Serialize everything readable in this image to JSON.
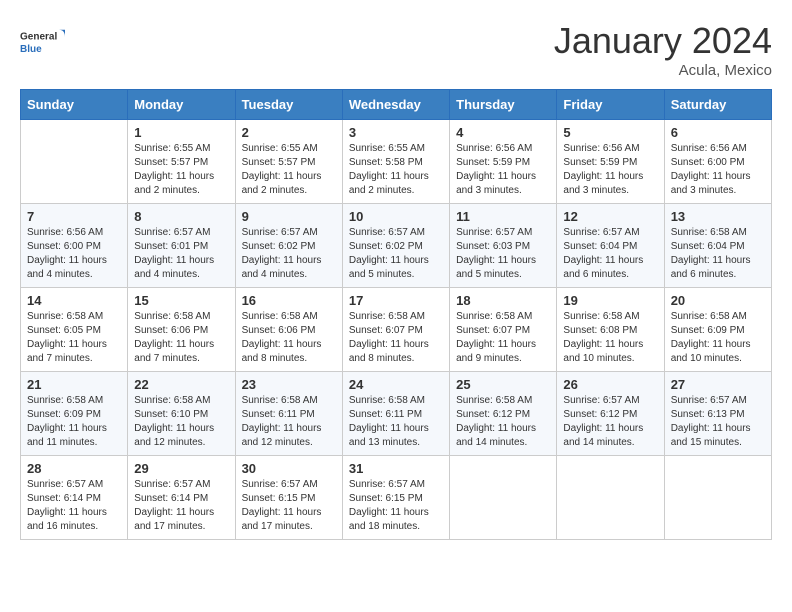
{
  "logo": {
    "general": "General",
    "blue": "Blue"
  },
  "header": {
    "month": "January 2024",
    "location": "Acula, Mexico"
  },
  "weekdays": [
    "Sunday",
    "Monday",
    "Tuesday",
    "Wednesday",
    "Thursday",
    "Friday",
    "Saturday"
  ],
  "weeks": [
    [
      {
        "day": null,
        "sunrise": null,
        "sunset": null,
        "daylight": null
      },
      {
        "day": "1",
        "sunrise": "Sunrise: 6:55 AM",
        "sunset": "Sunset: 5:57 PM",
        "daylight": "Daylight: 11 hours and 2 minutes."
      },
      {
        "day": "2",
        "sunrise": "Sunrise: 6:55 AM",
        "sunset": "Sunset: 5:57 PM",
        "daylight": "Daylight: 11 hours and 2 minutes."
      },
      {
        "day": "3",
        "sunrise": "Sunrise: 6:55 AM",
        "sunset": "Sunset: 5:58 PM",
        "daylight": "Daylight: 11 hours and 2 minutes."
      },
      {
        "day": "4",
        "sunrise": "Sunrise: 6:56 AM",
        "sunset": "Sunset: 5:59 PM",
        "daylight": "Daylight: 11 hours and 3 minutes."
      },
      {
        "day": "5",
        "sunrise": "Sunrise: 6:56 AM",
        "sunset": "Sunset: 5:59 PM",
        "daylight": "Daylight: 11 hours and 3 minutes."
      },
      {
        "day": "6",
        "sunrise": "Sunrise: 6:56 AM",
        "sunset": "Sunset: 6:00 PM",
        "daylight": "Daylight: 11 hours and 3 minutes."
      }
    ],
    [
      {
        "day": "7",
        "sunrise": "Sunrise: 6:56 AM",
        "sunset": "Sunset: 6:00 PM",
        "daylight": "Daylight: 11 hours and 4 minutes."
      },
      {
        "day": "8",
        "sunrise": "Sunrise: 6:57 AM",
        "sunset": "Sunset: 6:01 PM",
        "daylight": "Daylight: 11 hours and 4 minutes."
      },
      {
        "day": "9",
        "sunrise": "Sunrise: 6:57 AM",
        "sunset": "Sunset: 6:02 PM",
        "daylight": "Daylight: 11 hours and 4 minutes."
      },
      {
        "day": "10",
        "sunrise": "Sunrise: 6:57 AM",
        "sunset": "Sunset: 6:02 PM",
        "daylight": "Daylight: 11 hours and 5 minutes."
      },
      {
        "day": "11",
        "sunrise": "Sunrise: 6:57 AM",
        "sunset": "Sunset: 6:03 PM",
        "daylight": "Daylight: 11 hours and 5 minutes."
      },
      {
        "day": "12",
        "sunrise": "Sunrise: 6:57 AM",
        "sunset": "Sunset: 6:04 PM",
        "daylight": "Daylight: 11 hours and 6 minutes."
      },
      {
        "day": "13",
        "sunrise": "Sunrise: 6:58 AM",
        "sunset": "Sunset: 6:04 PM",
        "daylight": "Daylight: 11 hours and 6 minutes."
      }
    ],
    [
      {
        "day": "14",
        "sunrise": "Sunrise: 6:58 AM",
        "sunset": "Sunset: 6:05 PM",
        "daylight": "Daylight: 11 hours and 7 minutes."
      },
      {
        "day": "15",
        "sunrise": "Sunrise: 6:58 AM",
        "sunset": "Sunset: 6:06 PM",
        "daylight": "Daylight: 11 hours and 7 minutes."
      },
      {
        "day": "16",
        "sunrise": "Sunrise: 6:58 AM",
        "sunset": "Sunset: 6:06 PM",
        "daylight": "Daylight: 11 hours and 8 minutes."
      },
      {
        "day": "17",
        "sunrise": "Sunrise: 6:58 AM",
        "sunset": "Sunset: 6:07 PM",
        "daylight": "Daylight: 11 hours and 8 minutes."
      },
      {
        "day": "18",
        "sunrise": "Sunrise: 6:58 AM",
        "sunset": "Sunset: 6:07 PM",
        "daylight": "Daylight: 11 hours and 9 minutes."
      },
      {
        "day": "19",
        "sunrise": "Sunrise: 6:58 AM",
        "sunset": "Sunset: 6:08 PM",
        "daylight": "Daylight: 11 hours and 10 minutes."
      },
      {
        "day": "20",
        "sunrise": "Sunrise: 6:58 AM",
        "sunset": "Sunset: 6:09 PM",
        "daylight": "Daylight: 11 hours and 10 minutes."
      }
    ],
    [
      {
        "day": "21",
        "sunrise": "Sunrise: 6:58 AM",
        "sunset": "Sunset: 6:09 PM",
        "daylight": "Daylight: 11 hours and 11 minutes."
      },
      {
        "day": "22",
        "sunrise": "Sunrise: 6:58 AM",
        "sunset": "Sunset: 6:10 PM",
        "daylight": "Daylight: 11 hours and 12 minutes."
      },
      {
        "day": "23",
        "sunrise": "Sunrise: 6:58 AM",
        "sunset": "Sunset: 6:11 PM",
        "daylight": "Daylight: 11 hours and 12 minutes."
      },
      {
        "day": "24",
        "sunrise": "Sunrise: 6:58 AM",
        "sunset": "Sunset: 6:11 PM",
        "daylight": "Daylight: 11 hours and 13 minutes."
      },
      {
        "day": "25",
        "sunrise": "Sunrise: 6:58 AM",
        "sunset": "Sunset: 6:12 PM",
        "daylight": "Daylight: 11 hours and 14 minutes."
      },
      {
        "day": "26",
        "sunrise": "Sunrise: 6:57 AM",
        "sunset": "Sunset: 6:12 PM",
        "daylight": "Daylight: 11 hours and 14 minutes."
      },
      {
        "day": "27",
        "sunrise": "Sunrise: 6:57 AM",
        "sunset": "Sunset: 6:13 PM",
        "daylight": "Daylight: 11 hours and 15 minutes."
      }
    ],
    [
      {
        "day": "28",
        "sunrise": "Sunrise: 6:57 AM",
        "sunset": "Sunset: 6:14 PM",
        "daylight": "Daylight: 11 hours and 16 minutes."
      },
      {
        "day": "29",
        "sunrise": "Sunrise: 6:57 AM",
        "sunset": "Sunset: 6:14 PM",
        "daylight": "Daylight: 11 hours and 17 minutes."
      },
      {
        "day": "30",
        "sunrise": "Sunrise: 6:57 AM",
        "sunset": "Sunset: 6:15 PM",
        "daylight": "Daylight: 11 hours and 17 minutes."
      },
      {
        "day": "31",
        "sunrise": "Sunrise: 6:57 AM",
        "sunset": "Sunset: 6:15 PM",
        "daylight": "Daylight: 11 hours and 18 minutes."
      },
      {
        "day": null,
        "sunrise": null,
        "sunset": null,
        "daylight": null
      },
      {
        "day": null,
        "sunrise": null,
        "sunset": null,
        "daylight": null
      },
      {
        "day": null,
        "sunrise": null,
        "sunset": null,
        "daylight": null
      }
    ]
  ]
}
